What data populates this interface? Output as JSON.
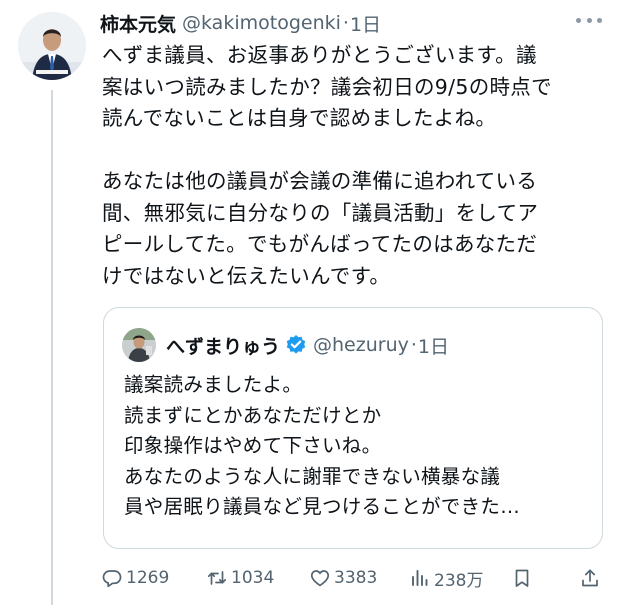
{
  "post": {
    "author_name": "柿本元気",
    "author_handle": "@kakimotogenki",
    "time_sep": "·",
    "time": "1日",
    "body": "へずま議員、お返事ありがとうございます。議\n案はいつ読みましたか？議会初日の9/5の時点で\n読んでないことは自身で認めましたよね。\n\nあなたは他の議員が会議の準備に追われている\n間、無邪気に自分なりの「議員活動」をしてア\nピールしてた。でもがんばってたのはあなただ\nけではないと伝えたいんです。"
  },
  "quote": {
    "author_name": "へずまりゅう",
    "author_handle": "@hezuruy",
    "time_sep": "·",
    "time": "1日",
    "body": "議案読みましたよ。\n読まずにとかあなただけとか\n印象操作はやめて下さいね。\nあなたのような人に謝罪できない横暴な議\n員や居眠り議員など見つけることができた…"
  },
  "actions": {
    "reply_count": "1269",
    "repost_count": "1034",
    "like_count": "3383",
    "view_count": "238万"
  },
  "icons": {
    "more": "more-dots-icon",
    "verified": "verified-badge-icon",
    "reply": "reply-icon",
    "repost": "repost-icon",
    "like": "like-icon",
    "views": "views-icon",
    "bookmark": "bookmark-icon",
    "share": "share-icon"
  },
  "colors": {
    "verified": "#1d9bf0",
    "secondary_text": "#536471"
  }
}
